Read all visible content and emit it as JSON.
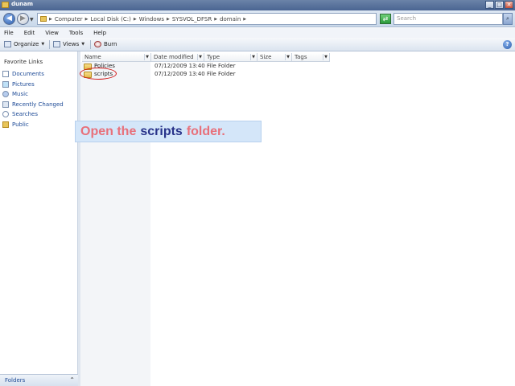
{
  "window": {
    "title": "dunam"
  },
  "address": {
    "crumbs": [
      "Computer",
      "Local Disk (C:)",
      "Windows",
      "SYSVOL_DFSR",
      "domain"
    ],
    "search_placeholder": "Search"
  },
  "menu": [
    "File",
    "Edit",
    "View",
    "Tools",
    "Help"
  ],
  "toolbar": {
    "organize": "Organize",
    "views": "Views",
    "burn": "Burn"
  },
  "nav": {
    "title": "Favorite Links",
    "links": [
      "Documents",
      "Pictures",
      "Music",
      "Recently Changed",
      "Searches",
      "Public"
    ],
    "folders_label": "Folders"
  },
  "columns": [
    "Name",
    "Date modified",
    "Type",
    "Size",
    "Tags"
  ],
  "files": [
    {
      "name": "Policies",
      "date": "07/12/2009 13:40",
      "type": "File Folder"
    },
    {
      "name": "scripts",
      "date": "07/12/2009 13:40",
      "type": "File Folder"
    }
  ],
  "caption": {
    "part1": "Open the",
    "part2": "scripts",
    "part3": "folder."
  },
  "colors": {
    "caption_bg": "#d4e6f9",
    "caption_pink": "#e8707a",
    "caption_navy": "#28338a",
    "ring": "#d01818"
  }
}
